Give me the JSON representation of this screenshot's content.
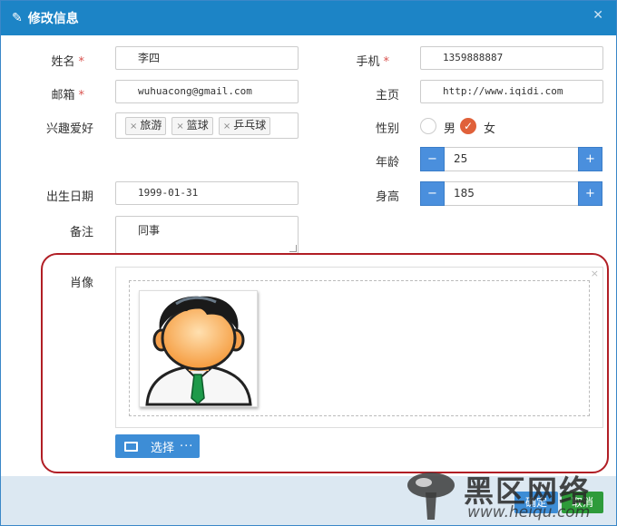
{
  "dialog": {
    "title": "修改信息"
  },
  "form": {
    "name": {
      "label": "姓名",
      "value": "李四",
      "required_mark": "*"
    },
    "mobile": {
      "label": "手机",
      "value": "1359888887",
      "required_mark": "*"
    },
    "email": {
      "label": "邮箱",
      "value": "wuhuacong@gmail.com",
      "required_mark": "*"
    },
    "homepage": {
      "label": "主页",
      "value": "http://www.iqidi.com"
    },
    "hobbies": {
      "label": "兴趣爱好",
      "tags": [
        "旅游",
        "篮球",
        "乒乓球"
      ],
      "remove_glyph": "×"
    },
    "gender": {
      "label": "性别",
      "options": [
        "男",
        "女"
      ],
      "selected": "女"
    },
    "age": {
      "label": "年龄",
      "value": "25",
      "minus": "−",
      "plus": "+"
    },
    "birthday": {
      "label": "出生日期",
      "value": "1999-01-31"
    },
    "height": {
      "label": "身高",
      "value": "185",
      "minus": "−",
      "plus": "+"
    },
    "note": {
      "label": "备注",
      "value": "同事"
    },
    "portrait": {
      "label": "肖像",
      "remove_glyph": "×"
    }
  },
  "upload": {
    "select_label": "选择",
    "dots": "···"
  },
  "footer": {
    "ok_label": "确定",
    "cancel_label": "取消"
  },
  "watermark": {
    "cn_text": "黑区网络",
    "url_text": "www.heiqu.com"
  },
  "colors": {
    "header": "#1c84c6",
    "primary": "#3d8dd6",
    "success": "#2e9b3a",
    "required": "#d9534f",
    "radio_checked": "#e0613a",
    "highlight": "#b11e25"
  }
}
